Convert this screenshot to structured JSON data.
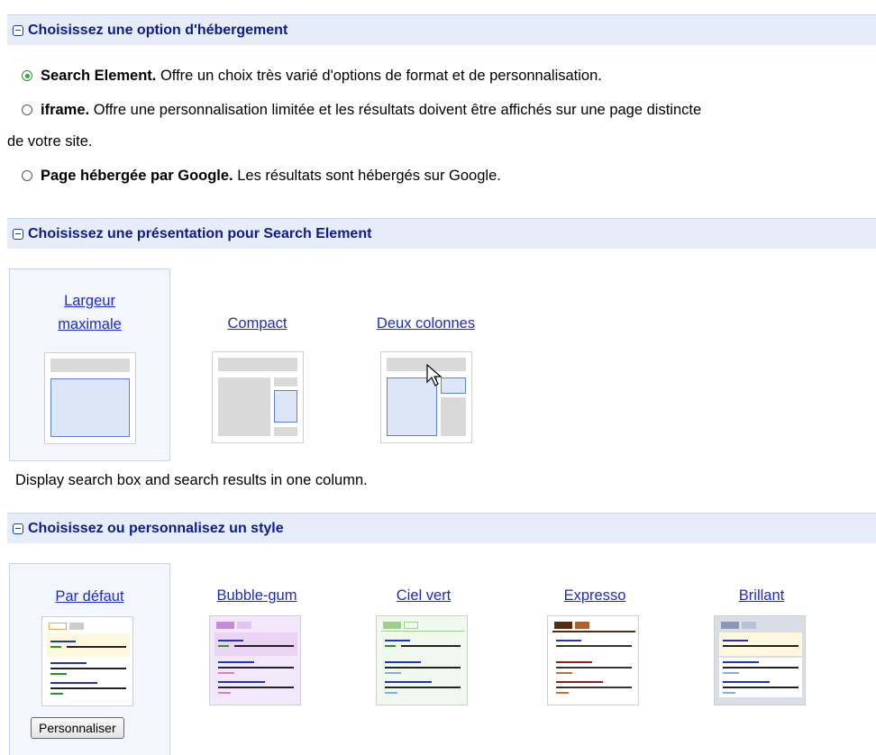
{
  "sections": {
    "hosting": {
      "title": "Choisissez une option d'hébergement"
    },
    "layout": {
      "title": "Choisissez une présentation pour Search Element"
    },
    "style": {
      "title": "Choisissez ou personnalisez un style"
    }
  },
  "hosting_options": [
    {
      "name": "Search Element.",
      "desc": " Offre un choix très varié d'options de format et de personnalisation.",
      "checked": true
    },
    {
      "name": "iframe.",
      "desc": " Offre une personnalisation limitée et les résultats doivent être affichés sur une page distincte",
      "desc2": "de votre site.",
      "checked": false
    },
    {
      "name": "Page hébergée par Google.",
      "desc": " Les résultats sont hébergés sur Google.",
      "checked": false
    }
  ],
  "layouts": {
    "full_line1": "Largeur",
    "full_line2": "maximale",
    "compact": "Compact",
    "two_col": "Deux colonnes",
    "selected": "full"
  },
  "layout_description": "Display search box and search results in one column.",
  "styles": {
    "default": "Par défaut",
    "bubblegum": "Bubble-gum",
    "ciel": "Ciel vert",
    "expresso": "Expresso",
    "brillant": "Brillant",
    "selected": "default"
  },
  "customize_label": "Personnaliser",
  "colors": {
    "header_bg": "#e6ecf8",
    "header_text": "#0d1b8c",
    "link": "#1c2cc8"
  }
}
